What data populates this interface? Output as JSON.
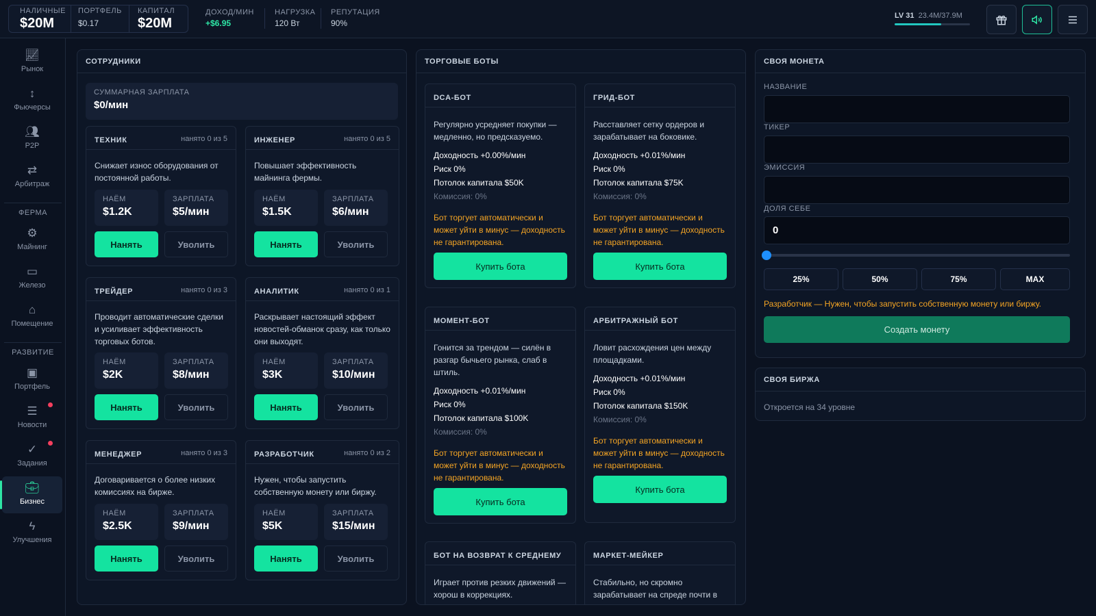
{
  "header": {
    "stats": [
      {
        "label": "НАЛИЧНЫЕ",
        "value": "$20M"
      },
      {
        "label": "ПОРТФЕЛЬ",
        "value": "$0.17"
      },
      {
        "label": "КАПИТАЛ",
        "value": "$20M"
      }
    ],
    "mini": [
      {
        "label": "ДОХОД/МИН",
        "value": "+$6.95"
      },
      {
        "label": "НАГРУЗКА",
        "value": "120 Вт"
      },
      {
        "label": "РЕПУТАЦИЯ",
        "value": "90%"
      }
    ],
    "level": {
      "label": "LV 31",
      "xp": "23.4M/37.9M",
      "progress": 0.62
    },
    "buttons": {
      "gift_icon": "gift-icon",
      "sound_icon": "speaker-icon",
      "menu_icon": "menu-icon"
    }
  },
  "sidebar": {
    "items": [
      {
        "label": "Рынок",
        "icon": "chart-line-icon"
      },
      {
        "label": "Фьючерсы",
        "icon": "arrows-updown-icon"
      },
      {
        "label": "P2P",
        "icon": "users-icon"
      },
      {
        "label": "Арбитраж",
        "icon": "swap-icon"
      },
      {
        "label": "Майнинг",
        "icon": "cpu-icon"
      },
      {
        "label": "Железо",
        "icon": "hardware-icon"
      },
      {
        "label": "Помещение",
        "icon": "home-icon"
      },
      {
        "label": "Портфель",
        "icon": "wallet-icon"
      },
      {
        "label": "Новости",
        "icon": "news-icon"
      },
      {
        "label": "Задания",
        "icon": "check-circle-icon"
      },
      {
        "label": "Бизнес",
        "icon": "briefcase-icon"
      },
      {
        "label": "Улучшения",
        "icon": "bolt-icon"
      }
    ],
    "sections": {
      "farm": "ФЕРМА",
      "dev": "РАЗВИТИЕ"
    }
  },
  "staff": {
    "title": "СОТРУДНИКИ",
    "total_label": "СУММАРНАЯ ЗАРПЛАТА",
    "total_value": "$0/мин",
    "hire_label": "НАЁМ",
    "salary_label": "ЗАРПЛАТА",
    "hire_btn": "Нанять",
    "fire_btn": "Уволить",
    "roles": [
      {
        "name": "ТЕХНИК",
        "hired": "нанято 0 из 5",
        "desc": "Снижает износ оборудования от постоянной работы.",
        "hire": "$1.2K",
        "salary": "$5/мин"
      },
      {
        "name": "ИНЖЕНЕР",
        "hired": "нанято 0 из 5",
        "desc": "Повышает эффективность майнинга фермы.",
        "hire": "$1.5K",
        "salary": "$6/мин"
      },
      {
        "name": "ТРЕЙДЕР",
        "hired": "нанято 0 из 3",
        "desc": "Проводит автоматические сделки и усиливает эффективность торговых ботов.",
        "hire": "$2K",
        "salary": "$8/мин"
      },
      {
        "name": "АНАЛИТИК",
        "hired": "нанято 0 из 1",
        "desc": "Раскрывает настоящий эффект новостей-обманок сразу, как только они выходят.",
        "hire": "$3K",
        "salary": "$10/мин"
      },
      {
        "name": "МЕНЕДЖЕР",
        "hired": "нанято 0 из 3",
        "desc": "Договаривается о более низких комиссиях на бирже.",
        "hire": "$2.5K",
        "salary": "$9/мин"
      },
      {
        "name": "РАЗРАБОТЧИК",
        "hired": "нанято 0 из 2",
        "desc": "Нужен, чтобы запустить собственную монету или биржу.",
        "hire": "$5K",
        "salary": "$15/мин"
      }
    ]
  },
  "bots": {
    "title": "ТОРГОВЫЕ БОТЫ",
    "warning": "Бот торгует автоматически и может уйти в минус — доходность не гарантирована.",
    "buy_btn": "Купить бота",
    "items": [
      {
        "name": "DCA-БОТ",
        "desc": "Регулярно усредняет покупки — медленно, но предсказуемо.",
        "yield": "Доходность +0.00%/мин",
        "risk": "Риск 0%",
        "cap": "Потолок капитала $50K",
        "fee": "Комиссия: 0%"
      },
      {
        "name": "ГРИД-БОТ",
        "desc": "Расставляет сетку ордеров и зарабатывает на боковике.",
        "yield": "Доходность +0.01%/мин",
        "risk": "Риск 0%",
        "cap": "Потолок капитала $75K",
        "fee": "Комиссия: 0%"
      },
      {
        "name": "МОМЕНТ-БОТ",
        "desc": "Гонится за трендом — силён в разгар бычьего рынка, слаб в штиль.",
        "yield": "Доходность +0.01%/мин",
        "risk": "Риск 0%",
        "cap": "Потолок капитала $100K",
        "fee": "Комиссия: 0%"
      },
      {
        "name": "АРБИТРАЖНЫЙ БОТ",
        "desc": "Ловит расхождения цен между площадками.",
        "yield": "Доходность +0.01%/мин",
        "risk": "Риск 0%",
        "cap": "Потолок капитала $150K",
        "fee": "Комиссия: 0%"
      },
      {
        "name": "БОТ НА ВОЗВРАТ К СРЕДНЕМУ",
        "desc": "Играет против резких движений — хорош в коррекциях."
      },
      {
        "name": "МАРКЕТ-МЕЙКЕР",
        "desc": "Стабильно, но скромно зарабатывает на спреде почти в"
      }
    ]
  },
  "coin": {
    "title": "СВОЯ МОНЕТА",
    "fields": {
      "name": "НАЗВАНИЕ",
      "ticker": "ТИКЕР",
      "supply": "ЭМИССИЯ",
      "share": "ДОЛЯ СЕБЕ"
    },
    "share_value": "0",
    "share_fraction": 0,
    "presets": [
      "25%",
      "50%",
      "75%",
      "MAX"
    ],
    "requirement": "Разработчик — Нужен, чтобы запустить собственную монету или биржу.",
    "create_btn": "Создать монету"
  },
  "exchange": {
    "title": "СВОЯ БИРЖА",
    "note": "Откроется на 34 уровне"
  },
  "colors": {
    "accent": "#14e3a0",
    "warning": "#f5a524",
    "background": "#0b1220"
  }
}
